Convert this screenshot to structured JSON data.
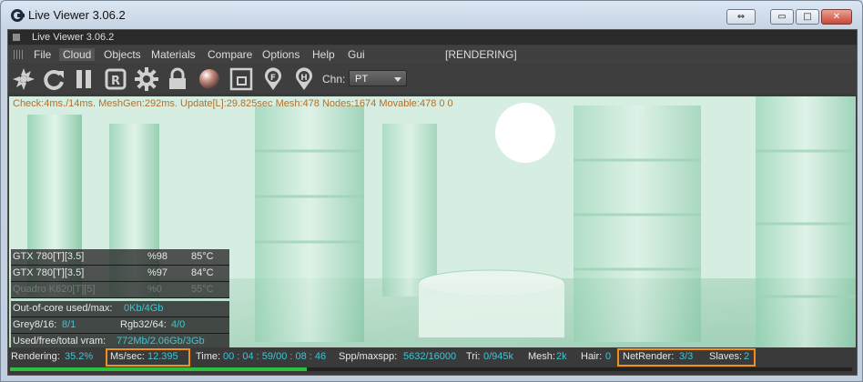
{
  "window": {
    "title": "Live Viewer 3.06.2",
    "controls": {
      "resize": "⇔",
      "minimize": "▭",
      "maximize": "□",
      "close": "✕"
    }
  },
  "subtitle": "Live Viewer 3.06.2",
  "menu": {
    "items": [
      "File",
      "Cloud",
      "Objects",
      "Materials",
      "Compare",
      "Options",
      "Help",
      "Gui"
    ],
    "active": "Cloud",
    "status": "[RENDERING]"
  },
  "toolbar": {
    "icons": [
      "aperture-icon",
      "reload-icon",
      "pause-icon",
      "render-region-icon",
      "gear-icon",
      "lock-icon",
      "material-ball-icon",
      "focus-frame-icon",
      "focus-pin-icon",
      "hdr-pin-icon"
    ],
    "chn_label": "Chn:",
    "chn_value": "PT"
  },
  "stats_line": "Check:4ms./14ms. MeshGen:292ms. Update[L]:29.825sec Mesh:478 Nodes:1674 Movable:478  0 0",
  "gpus": [
    {
      "name": "GTX 780[T][3.5]",
      "usage": "%98",
      "temp": "85°C",
      "active": true
    },
    {
      "name": "GTX 780[T][3.5]",
      "usage": "%97",
      "temp": "84°C",
      "active": true
    },
    {
      "name": "Quadro K620[T][5]",
      "usage": "%0",
      "temp": "55°C",
      "active": false
    }
  ],
  "memory": {
    "out_of_core_label": "Out-of-core used/max:",
    "out_of_core_value": "0Kb/4Gb",
    "grey_label": "Grey8/16:",
    "grey_value": "8/1",
    "rgb_label": "Rgb32/64:",
    "rgb_value": "4/0",
    "vram_label": "Used/free/total vram:",
    "vram_value": "772Mb/2.06Gb/3Gb"
  },
  "status": {
    "rendering_label": "Rendering:",
    "rendering_value": "35.2%",
    "ms_label": "Ms/sec:",
    "ms_value": "12.395",
    "time_label": "Time:",
    "time_value": "00 : 04 : 59/00 : 08 : 46",
    "spp_label": "Spp/maxspp:",
    "spp_value": "5632/16000",
    "tri_label": "Tri:",
    "tri_value": "0/945k",
    "mesh_label": "Mesh:",
    "mesh_value": "2k",
    "hair_label": "Hair:",
    "hair_value": "0",
    "netrender_label": "NetRender:",
    "netrender_value": "3/3",
    "slaves_label": "Slaves:",
    "slaves_value": "2",
    "progress": 0.352
  },
  "colors": {
    "accent_teal": "#3fc4d2",
    "highlight": "#f0901c",
    "progress": "#2fbf3f",
    "stats": "#b3702a"
  }
}
